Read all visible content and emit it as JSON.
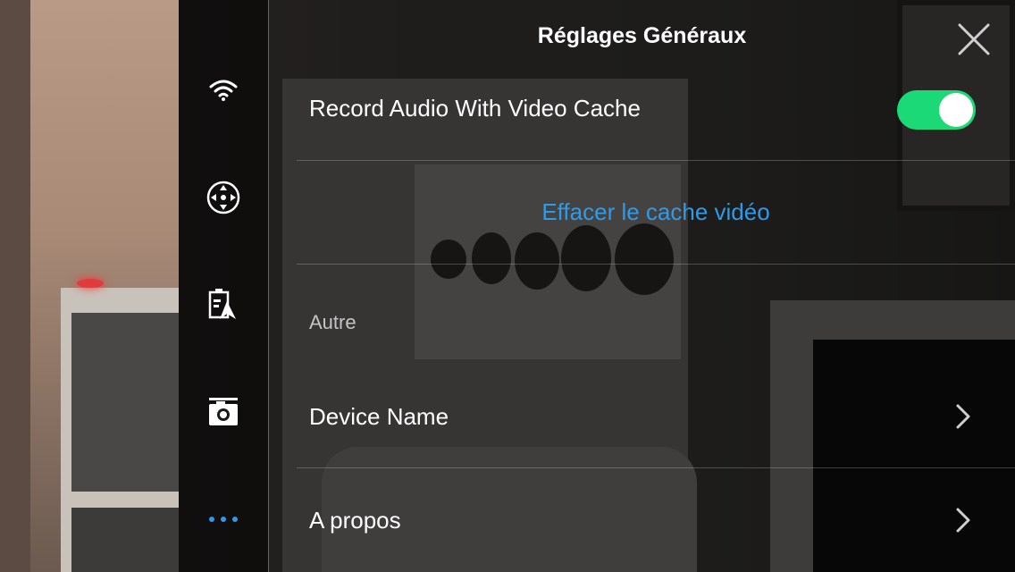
{
  "header": {
    "title": "Réglages Généraux"
  },
  "sidebar": {
    "items": [
      {
        "name": "wifi",
        "icon": "wifi-icon"
      },
      {
        "name": "controls",
        "icon": "move-joystick-icon"
      },
      {
        "name": "battery-gps",
        "icon": "battery-gps-icon"
      },
      {
        "name": "camera",
        "icon": "camera-icon"
      },
      {
        "name": "more",
        "icon": "more-dots-icon"
      }
    ]
  },
  "settings": {
    "record_audio": {
      "label": "Record Audio With Video Cache",
      "enabled": true
    },
    "clear_cache_label": "Effacer le cache vidéo",
    "section_other": "Autre",
    "device_name_label": "Device Name",
    "about_label": "A propos"
  },
  "colors": {
    "accent_link": "#2f9be8",
    "toggle_on": "#1bd976",
    "active_icon": "#2f9be8"
  }
}
